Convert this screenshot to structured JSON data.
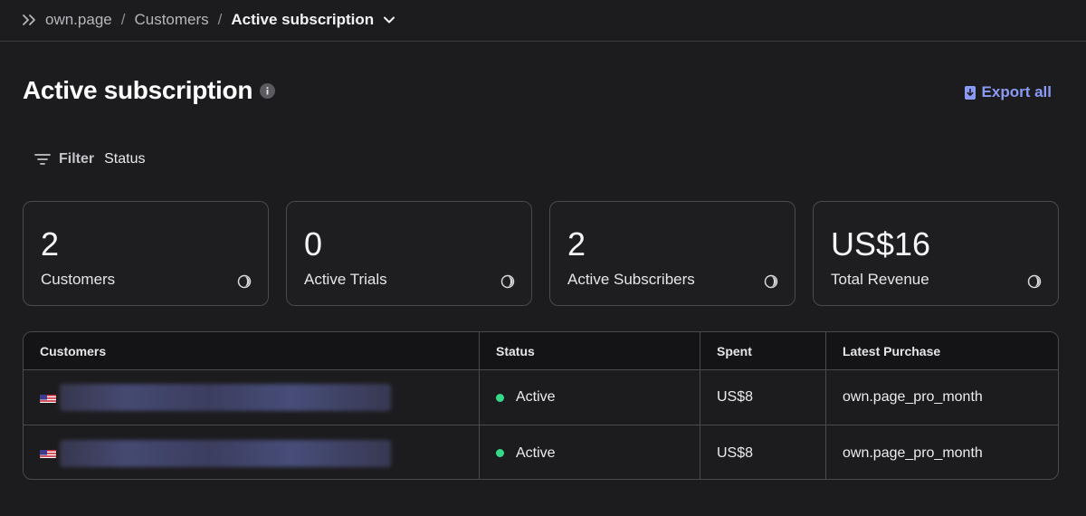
{
  "breadcrumb": {
    "items": [
      "own.page",
      "Customers"
    ],
    "current": "Active subscription"
  },
  "header": {
    "title": "Active subscription",
    "export_label": "Export all"
  },
  "filter": {
    "label": "Filter",
    "value": "Status"
  },
  "stats": [
    {
      "value": "2",
      "label": "Customers"
    },
    {
      "value": "0",
      "label": "Active Trials"
    },
    {
      "value": "2",
      "label": "Active Subscribers"
    },
    {
      "value": "US$16",
      "label": "Total Revenue"
    }
  ],
  "table": {
    "columns": [
      "Customers",
      "Status",
      "Spent",
      "Latest Purchase"
    ],
    "rows": [
      {
        "status": "Active",
        "spent": "US$8",
        "latest_purchase": "own.page_pro_month"
      },
      {
        "status": "Active",
        "spent": "US$8",
        "latest_purchase": "own.page_pro_month"
      }
    ]
  },
  "colors": {
    "accent": "#8b9af5",
    "status_active": "#35d98a",
    "background": "#1c1b1d"
  },
  "icons": {
    "breadcrumb": "double-chevron-right-icon",
    "dropdown": "chevron-down-icon",
    "info": "info-icon",
    "export": "download-icon",
    "filter": "filter-icon",
    "card": "half-circle-icon",
    "flag": "us-flag-icon"
  }
}
